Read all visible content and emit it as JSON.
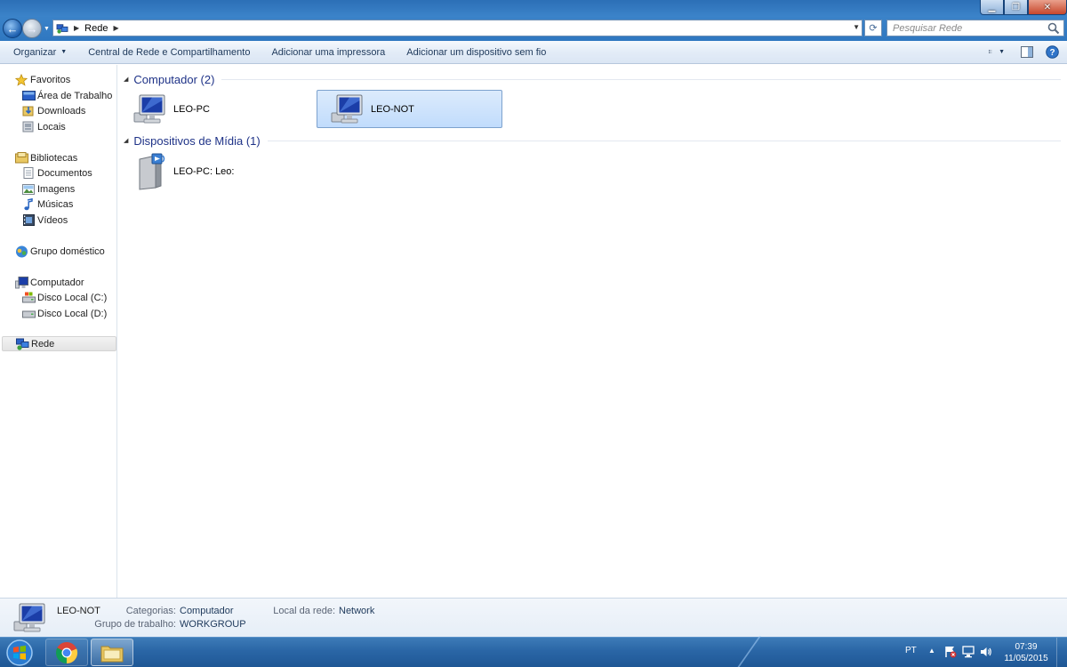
{
  "window": {
    "controls": {
      "minimize": "▁",
      "maximize": "❐",
      "close": "✕"
    }
  },
  "nav": {
    "back": "←",
    "forward": "→",
    "history": "▼"
  },
  "address": {
    "crumbs": [
      "Rede"
    ],
    "separator": "▶",
    "dropdown": "▼",
    "refresh": "⟳"
  },
  "search": {
    "placeholder": "Pesquisar Rede"
  },
  "toolbar": {
    "organize": "Organizar",
    "network_center": "Central de Rede e Compartilhamento",
    "add_printer": "Adicionar uma impressora",
    "add_wireless": "Adicionar um dispositivo sem fio",
    "dropdown_arrow": "▼"
  },
  "sidebar": {
    "favorites": {
      "label": "Favoritos",
      "items": [
        "Área de Trabalho",
        "Downloads",
        "Locais"
      ]
    },
    "libraries": {
      "label": "Bibliotecas",
      "items": [
        "Documentos",
        "Imagens",
        "Músicas",
        "Vídeos"
      ]
    },
    "homegroup": {
      "label": "Grupo doméstico"
    },
    "computer": {
      "label": "Computador",
      "items": [
        "Disco Local (C:)",
        "Disco Local (D:)"
      ]
    },
    "network": {
      "label": "Rede"
    }
  },
  "content": {
    "groups": [
      {
        "title": "Computador (2)",
        "items": [
          "LEO-PC",
          "LEO-NOT"
        ]
      },
      {
        "title": "Dispositivos de Mídia (1)",
        "items": [
          "LEO-PC: Leo:"
        ]
      }
    ],
    "collapse_glyph": "◢"
  },
  "details": {
    "name": "LEO-NOT",
    "categories_label": "Categorias:",
    "categories_value": "Computador",
    "workgroup_label": "Grupo de trabalho:",
    "workgroup_value": "WORKGROUP",
    "network_label": "Local da rede:",
    "network_value": "Network"
  },
  "taskbar": {
    "language": "PT",
    "tray_up": "▲",
    "time": "07:39",
    "date": "11/05/2015"
  },
  "colors": {
    "title_bar": "#2f77c0",
    "selection": "#c1dcfc",
    "group_header": "#1e3287",
    "taskbar": "#2a66a6"
  }
}
